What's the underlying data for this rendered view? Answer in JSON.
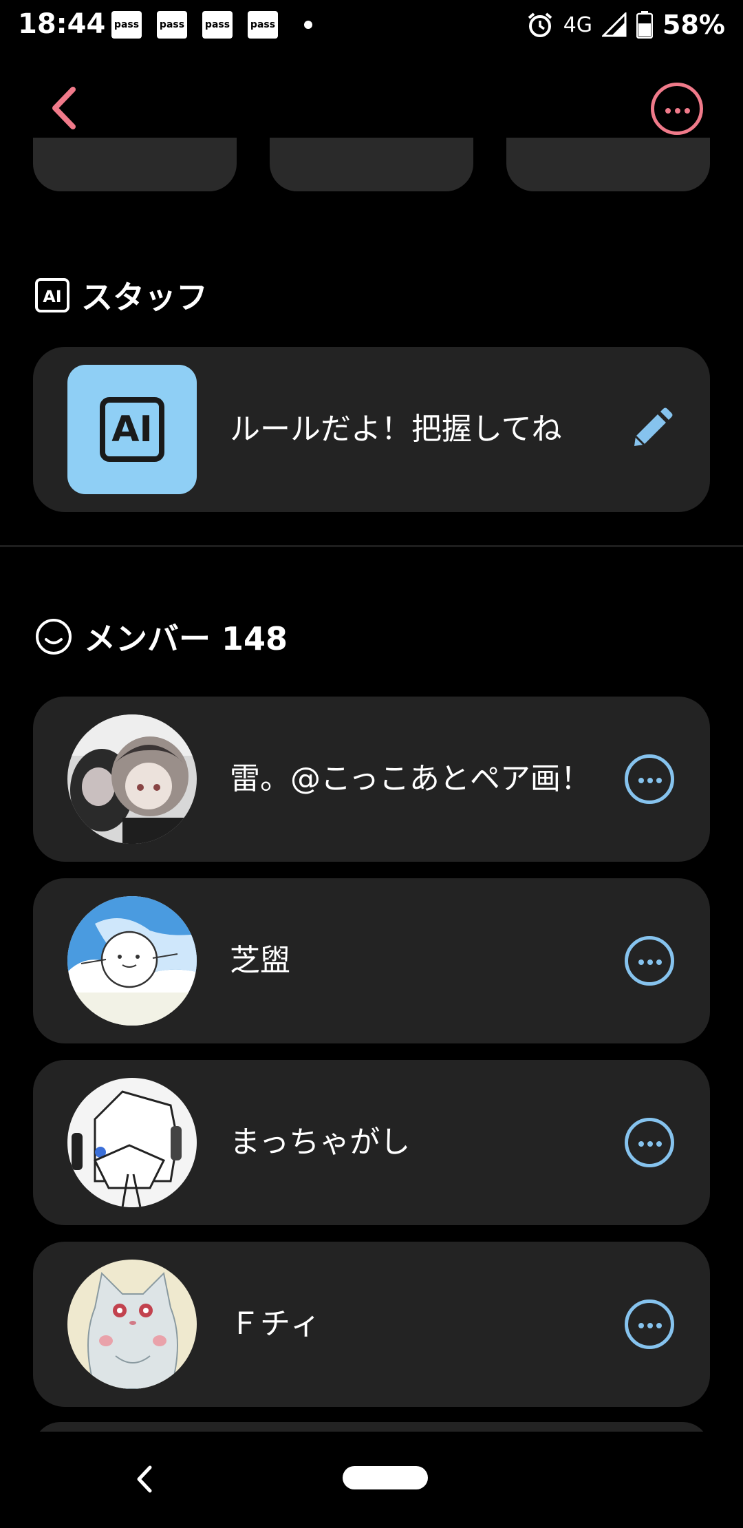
{
  "status_bar": {
    "time": "18:44",
    "notifications": [
      "pass",
      "pass",
      "pass",
      "pass"
    ],
    "network": "4G",
    "battery": "58%"
  },
  "top_bar": {
    "back_icon": "chevron-left-icon",
    "menu_icon": "more-horizontal-icon"
  },
  "staff_section": {
    "title": "スタッフ",
    "icon": "ai-icon",
    "item": {
      "name": "ルールだよ！把握してね",
      "avatar_text": "AI",
      "action_icon": "pencil-icon"
    }
  },
  "member_section": {
    "title": "メンバー 148",
    "icon": "smile-icon",
    "members": [
      {
        "name": "雷。@こっこあとペア画！",
        "avatar": "anime-girls-avatar"
      },
      {
        "name": "芝盥",
        "avatar": "snowman-sky-avatar"
      },
      {
        "name": "まっちゃがし",
        "avatar": "masked-character-avatar"
      },
      {
        "name": "Ｆチィ",
        "avatar": "white-cat-avatar"
      }
    ]
  },
  "colors": {
    "background": "#000000",
    "card": "#232323",
    "accent_pink": "#f07a8a",
    "accent_blue": "#86c3ee"
  }
}
